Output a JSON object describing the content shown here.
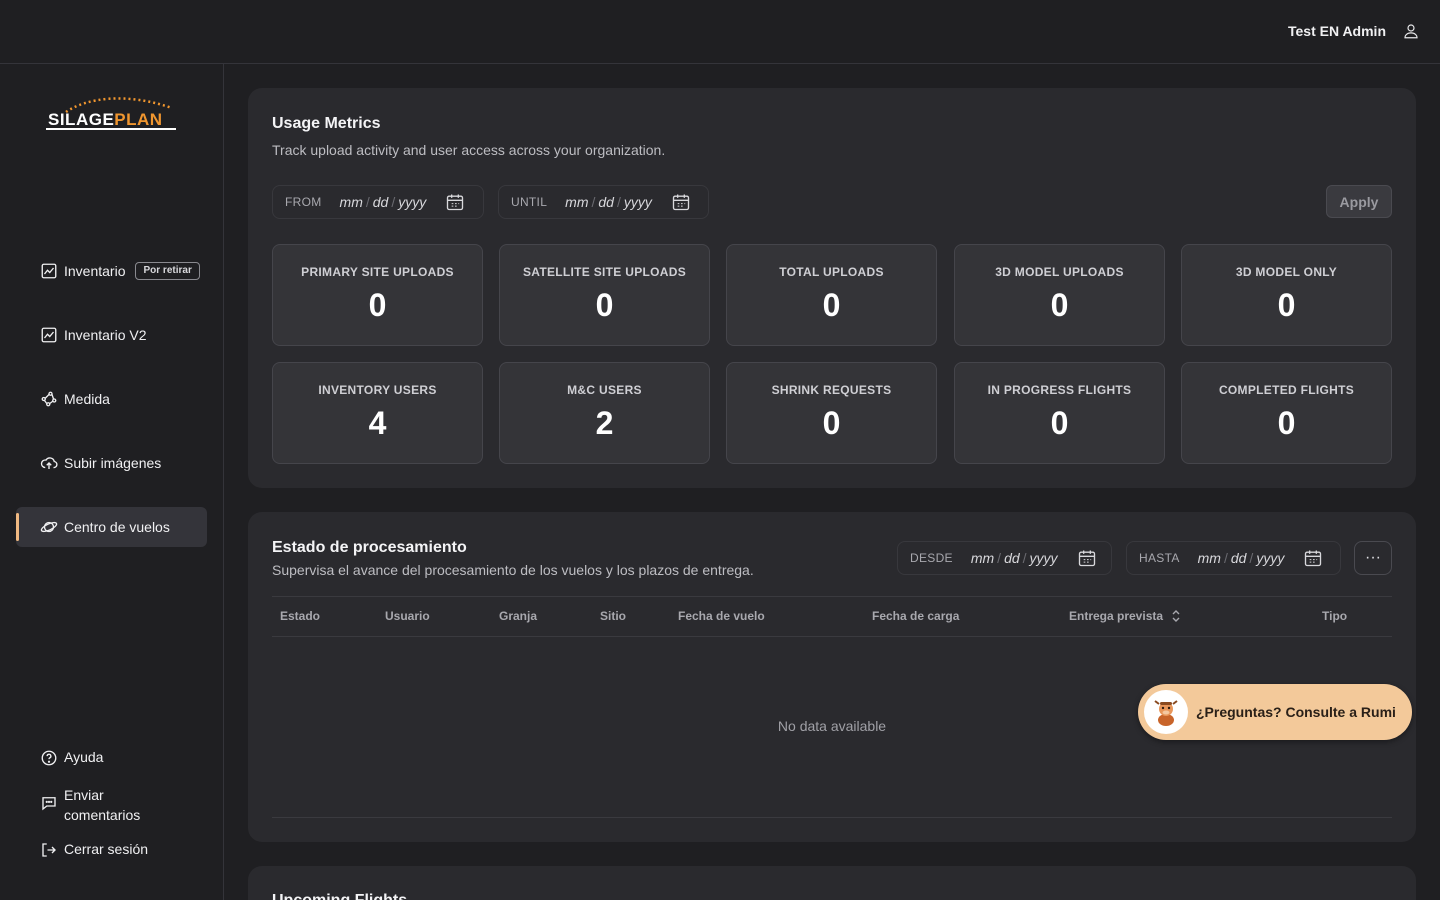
{
  "header": {
    "user_name": "Test EN Admin",
    "user_icon": "user-icon"
  },
  "brand": {
    "part1": "SILAGE",
    "part2": "PLAN",
    "accent": "#f0962f"
  },
  "sidebar": {
    "items": [
      {
        "label": "Inventario",
        "badge": "Por retirar",
        "icon": "chart-icon"
      },
      {
        "label": "Inventario V2",
        "icon": "chart-icon"
      },
      {
        "label": "Medida",
        "icon": "measure-icon"
      },
      {
        "label": "Subir imágenes",
        "icon": "cloud-upload-icon"
      },
      {
        "label": "Centro de vuelos",
        "icon": "planet-icon",
        "active": true
      }
    ],
    "bottom": [
      {
        "label": "Ayuda",
        "icon": "help-icon"
      },
      {
        "label": "Enviar comentarios",
        "icon": "chat-icon"
      },
      {
        "label": "Cerrar sesión",
        "icon": "logout-icon"
      }
    ]
  },
  "usage": {
    "title": "Usage Metrics",
    "subtitle": "Track upload activity and user access across your organization.",
    "from_label": "FROM",
    "until_label": "UNTIL",
    "date_mm": "mm",
    "date_dd": "dd",
    "date_yyyy": "yyyy",
    "apply_label": "Apply",
    "metrics": [
      {
        "label": "PRIMARY SITE UPLOADS",
        "value": "0"
      },
      {
        "label": "SATELLITE SITE UPLOADS",
        "value": "0"
      },
      {
        "label": "TOTAL UPLOADS",
        "value": "0"
      },
      {
        "label": "3D MODEL UPLOADS",
        "value": "0"
      },
      {
        "label": "3D MODEL ONLY",
        "value": "0"
      },
      {
        "label": "INVENTORY USERS",
        "value": "4"
      },
      {
        "label": "M&C USERS",
        "value": "2"
      },
      {
        "label": "SHRINK REQUESTS",
        "value": "0"
      },
      {
        "label": "IN PROGRESS FLIGHTS",
        "value": "0"
      },
      {
        "label": "COMPLETED FLIGHTS",
        "value": "0"
      }
    ]
  },
  "processing": {
    "title": "Estado de procesamiento",
    "subtitle": "Supervisa el avance del procesamiento de los vuelos y los plazos de entrega.",
    "from_label": "DESDE",
    "until_label": "HASTA",
    "more_label": "···",
    "columns": [
      "Estado",
      "Usuario",
      "Granja",
      "Sitio",
      "Fecha de vuelo",
      "Fecha de carga",
      "Entrega prevista",
      "Tipo"
    ],
    "empty": "No data available"
  },
  "upcoming": {
    "title": "Upcoming Flights"
  },
  "rumi": {
    "label": "¿Preguntas? Consulte a Rumi"
  }
}
